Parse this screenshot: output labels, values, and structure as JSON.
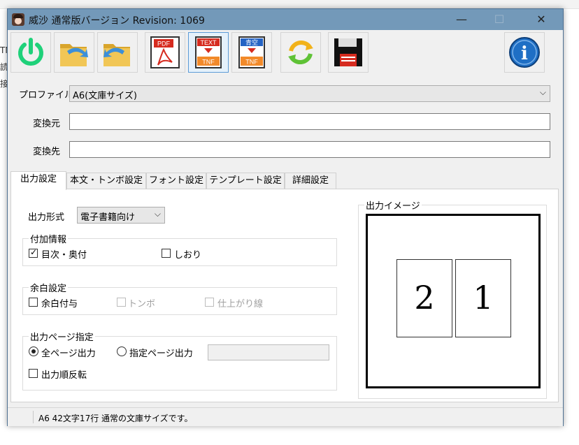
{
  "background": {
    "left_glyphs": [
      "TN",
      "読",
      "接"
    ]
  },
  "window": {
    "title": "威沙 通常版バージョン Revision: 1069",
    "controls": {
      "minimize": "—",
      "maximize": "☐",
      "close": "✕"
    }
  },
  "toolbar": {
    "buttons": [
      {
        "name": "power",
        "icon": "power-icon"
      },
      {
        "name": "open-folder",
        "icon": "folder-arrow-right-icon"
      },
      {
        "name": "back-folder",
        "icon": "folder-arrow-left-icon"
      },
      {
        "name": "pdf",
        "icon": "pdf-icon",
        "label": "PDF"
      },
      {
        "name": "text-to-tnf",
        "icon": "text-tnf-icon",
        "label": "TEXT",
        "sublabel": "TNF"
      },
      {
        "name": "aozora-to-tnf",
        "icon": "aozora-tnf-icon",
        "label": "青空",
        "sublabel": "TNF"
      },
      {
        "name": "refresh",
        "icon": "refresh-icon"
      },
      {
        "name": "save",
        "icon": "floppy-disk-icon"
      },
      {
        "name": "info",
        "icon": "info-icon",
        "label": "i"
      }
    ]
  },
  "form": {
    "profile_label": "プロファイル",
    "profile_value": "A6(文庫サイズ)",
    "source_label": "変換元",
    "source_value": "",
    "dest_label": "変換先",
    "dest_value": ""
  },
  "tabs": [
    "出力設定",
    "本文・トンボ設定",
    "フォント設定",
    "テンプレート設定",
    "詳細設定"
  ],
  "output": {
    "format_label": "出力形式",
    "format_value": "電子書籍向け",
    "extra_group": "付加情報",
    "toc_label": "目次・奥付",
    "toc_checked": true,
    "bookmark_label": "しおり",
    "bookmark_checked": false,
    "margin_group": "余白設定",
    "margin_label": "余白付与",
    "margin_checked": false,
    "tombo_label": "トンボ",
    "finish_label": "仕上がり線",
    "page_group": "出力ページ指定",
    "all_pages_label": "全ページ出力",
    "all_pages_selected": true,
    "specified_pages_label": "指定ページ出力",
    "specified_pages_value": "",
    "reverse_label": "出力順反転",
    "reverse_checked": false
  },
  "preview": {
    "label": "出力イメージ",
    "pages": [
      "2",
      "1"
    ]
  },
  "status": {
    "text": "A6 42文字17行 通常の文庫サイズです。"
  },
  "colors": {
    "titlebar": "#7399b9",
    "power_green": "#1fd17a",
    "info_blue": "#1f6fc5",
    "pdf_red": "#d62b1f"
  }
}
